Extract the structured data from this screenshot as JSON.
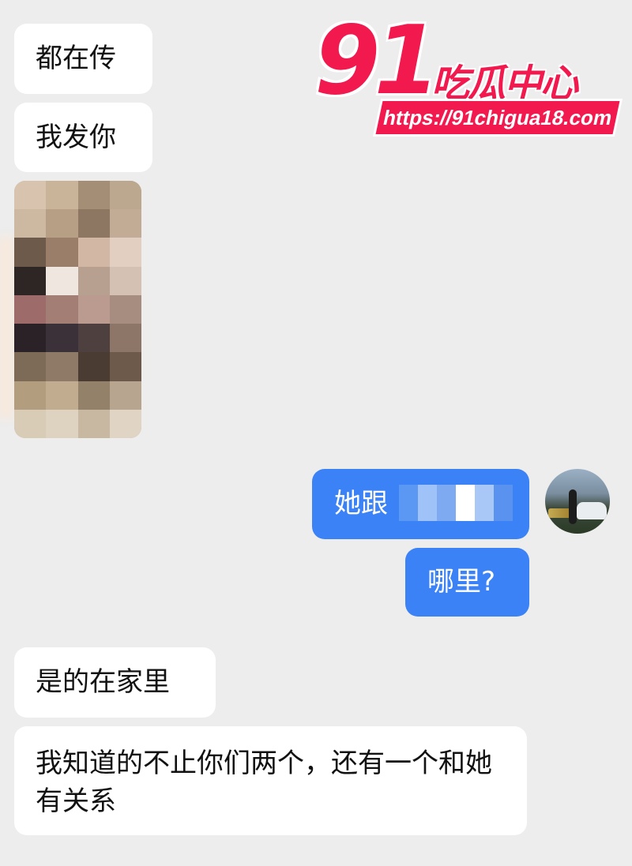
{
  "watermark": {
    "number": "91",
    "name": "吃瓜中心",
    "url": "https://91chigua18.com"
  },
  "messages": [
    {
      "side": "incoming",
      "text": "都在传"
    },
    {
      "side": "incoming",
      "text": "我发你"
    },
    {
      "side": "incoming",
      "type": "image",
      "content": "pixelated-photo"
    },
    {
      "side": "outgoing",
      "text": "她跟"
    },
    {
      "side": "outgoing",
      "text": "哪里?"
    },
    {
      "side": "incoming",
      "text": "是的在家里"
    },
    {
      "side": "incoming",
      "text": "我知道的不止你们两个，还有一个和她有关系"
    }
  ],
  "colors": {
    "background": "#ededed",
    "incoming_bubble": "#ffffff",
    "outgoing_bubble": "#3b82f6",
    "watermark": "#f2194f"
  },
  "photo_mosaic": [
    "#d8c4ae",
    "#c9b49a",
    "#a58e76",
    "#bca78f",
    "#cdb9a2",
    "#b79f86",
    "#8e7762",
    "#c2ac95",
    "#6d5a4a",
    "#9a7e6a",
    "#d3b7a5",
    "#e2cfc2",
    "#2e2624",
    "#efe6df",
    "#b8a090",
    "#d5c0b4",
    "#9c6b6a",
    "#a27e74",
    "#bb9b8f",
    "#a78c80",
    "#2b2228",
    "#3a3238",
    "#4f4040",
    "#8d7668",
    "#7d6b58",
    "#8e7a66",
    "#4a3c32",
    "#6d5a4a",
    "#b29d7f",
    "#c1ac90",
    "#948169",
    "#b7a58f",
    "#d9ccb6",
    "#ded2c0",
    "#c8b8a2",
    "#e0d4c4"
  ]
}
